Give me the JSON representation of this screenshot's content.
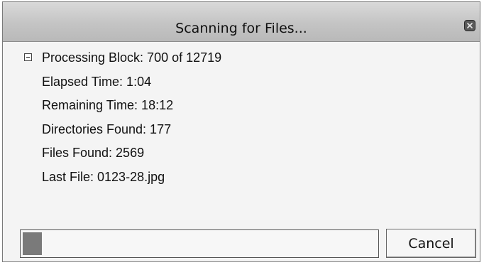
{
  "window": {
    "title": "Scanning for Files..."
  },
  "status": {
    "processing_block": "Processing Block: 700 of 12719",
    "elapsed_time": "Elapsed Time: 1:04",
    "remaining_time": "Remaining Time: 18:12",
    "directories_found": "Directories Found: 177",
    "files_found": "Files Found: 2569",
    "last_file": "Last File: 0123-28.jpg"
  },
  "progress": {
    "fraction": 0.055
  },
  "buttons": {
    "cancel_label": "Cancel"
  },
  "icons": {
    "close": "close-icon",
    "toggle": "collapse-toggle-icon"
  },
  "colors": {
    "titlebar": "#c4c4c4",
    "background": "#f4f4f4",
    "progress_fill": "#7a7a7a"
  }
}
